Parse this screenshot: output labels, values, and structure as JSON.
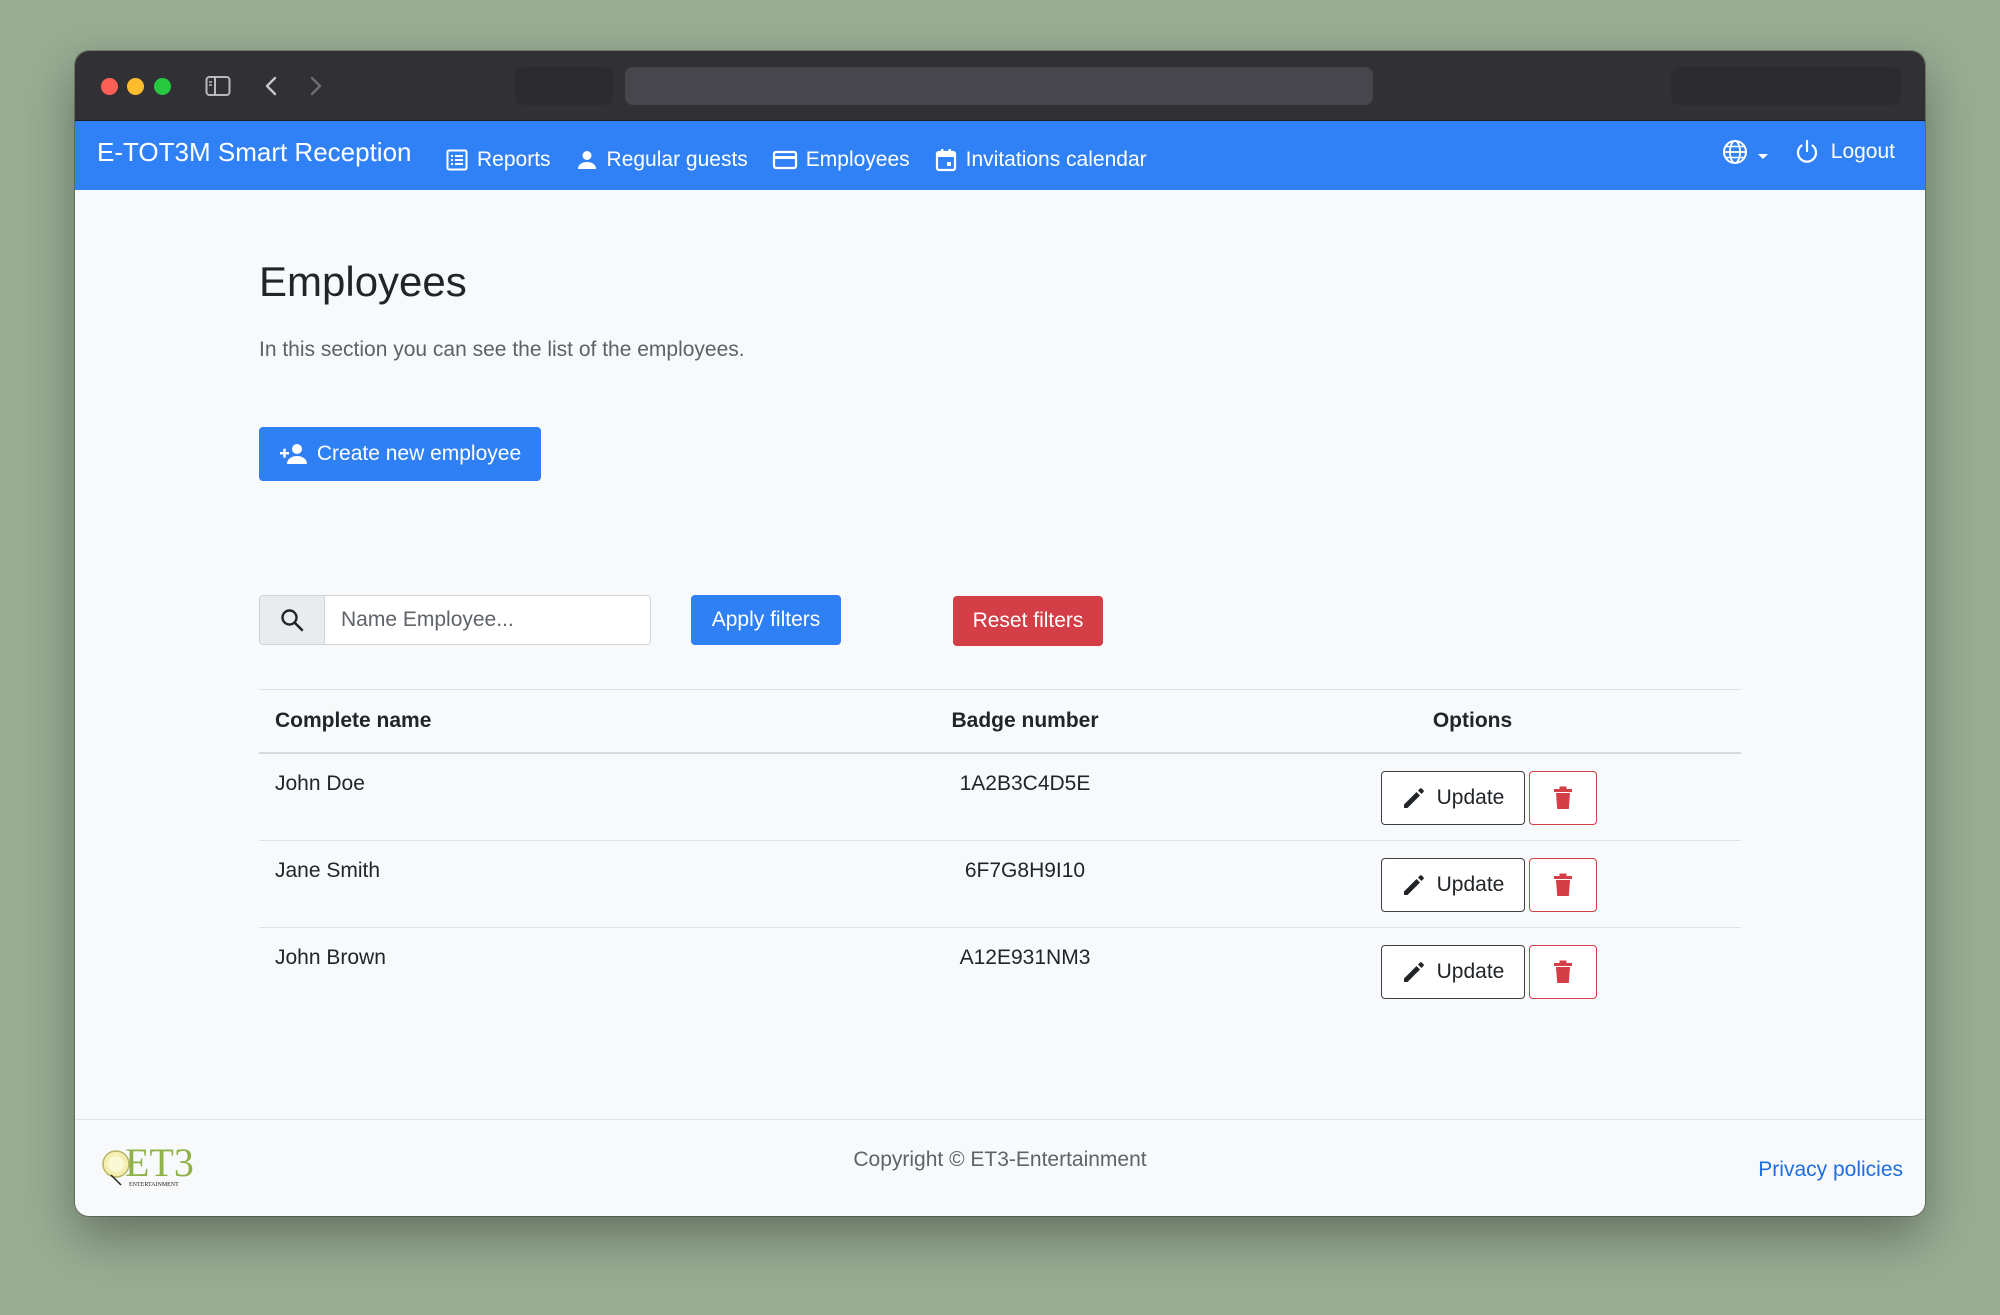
{
  "navbar": {
    "brand": "E-TOT3M Smart Reception",
    "links": [
      {
        "label": "Reports",
        "icon": "list-icon"
      },
      {
        "label": "Regular guests",
        "icon": "person-icon"
      },
      {
        "label": "Employees",
        "icon": "card-icon"
      },
      {
        "label": "Invitations calendar",
        "icon": "calendar-icon"
      }
    ],
    "logout_label": "Logout"
  },
  "main": {
    "title": "Employees",
    "description": "In this section you can see the list of the employees.",
    "create_label": "Create new employee",
    "search_placeholder": "Name Employee...",
    "apply_label": "Apply filters",
    "reset_label": "Reset filters"
  },
  "table": {
    "headers": {
      "name": "Complete name",
      "badge": "Badge number",
      "options": "Options"
    },
    "update_label": "Update",
    "rows": [
      {
        "name": "John Doe",
        "badge": "1A2B3C4D5E"
      },
      {
        "name": "Jane Smith",
        "badge": "6F7G8H9I10"
      },
      {
        "name": "John Brown",
        "badge": "A12E931NM3"
      }
    ]
  },
  "footer": {
    "logo_text": "ET3",
    "logo_subtext": "ENTERTAINMENT",
    "copyright": "Copyright © ET3-Entertainment",
    "privacy_label": "Privacy policies"
  },
  "colors": {
    "primary": "#3081f5",
    "danger": "#d43f47",
    "background": "#98ad94"
  }
}
